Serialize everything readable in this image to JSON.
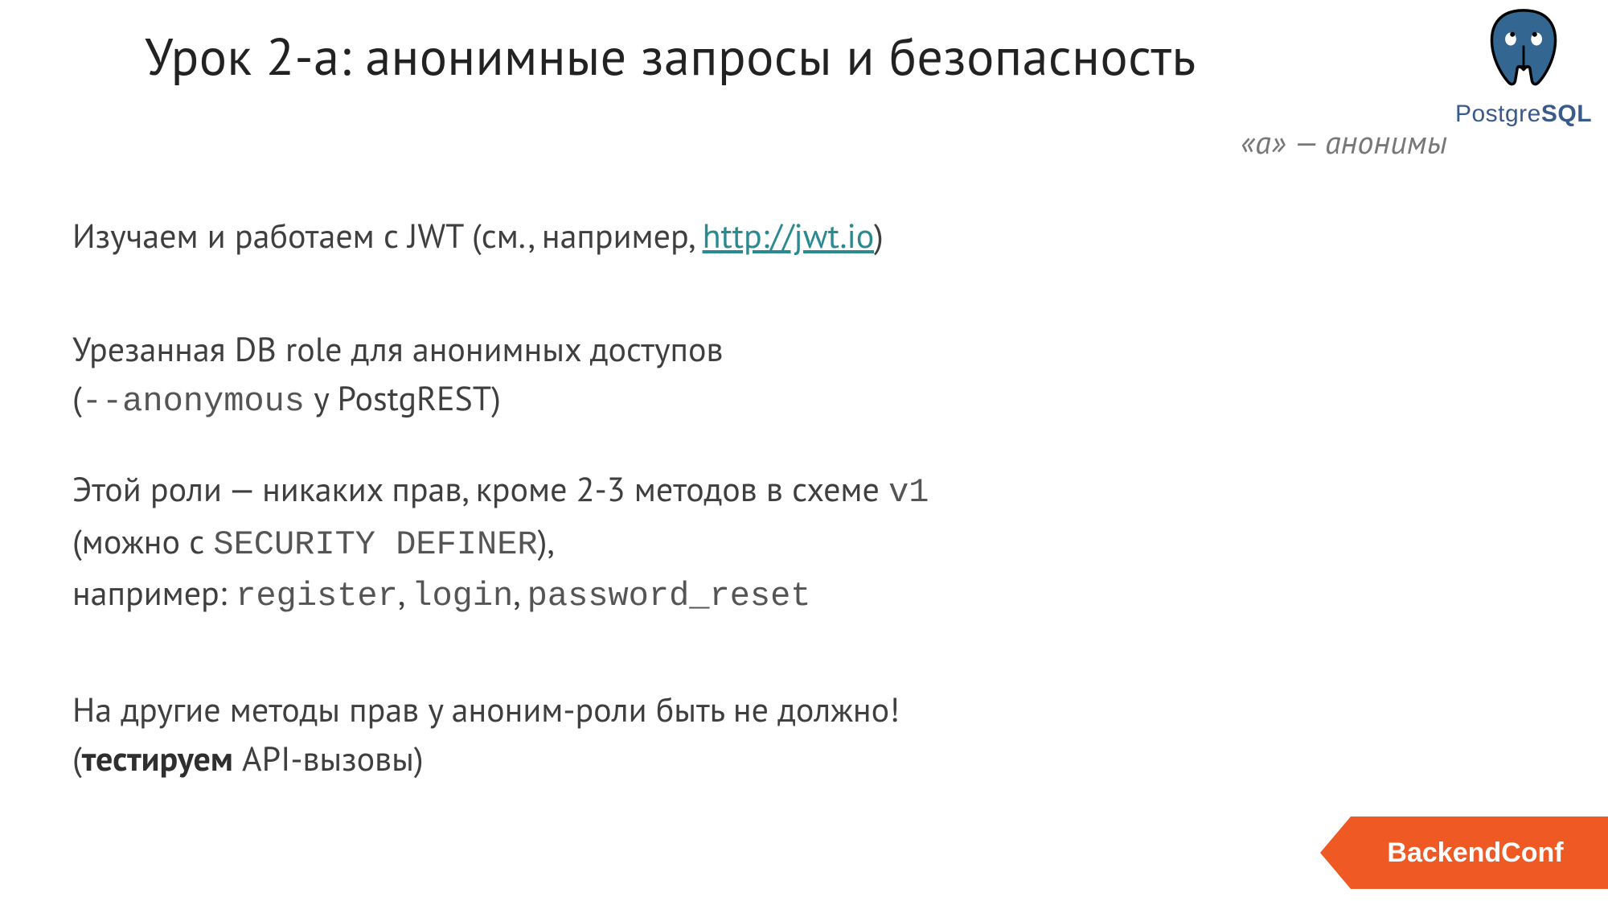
{
  "title": "Урок 2-а: анонимные запросы и безопасность",
  "subtitle": "«а» — анонимы",
  "p1_a": "Изучаем и работаем с JWT (см., например, ",
  "p1_link": "http://jwt.io",
  "p1_b": ")",
  "p2_a": "Урезанная DB role для анонимных доступов",
  "p2_b1": "(",
  "p2_code": "--anonymous",
  "p2_b2": " у PostgREST)",
  "p3_a": "Этой роли — никаких прав, кроме 2-3 методов в схеме ",
  "p3_code1": "v1",
  "p3_b": "(можно с ",
  "p3_code2": "SECURITY DEFINER",
  "p3_c": "),",
  "p3_d": "например: ",
  "p3_code3": "register",
  "p3_e": ", ",
  "p3_code4": "login",
  "p3_f": ", ",
  "p3_code5": "password_reset",
  "p4_a": "На другие методы прав у аноним-роли быть не должно!",
  "p4_b1": "(",
  "p4_bold": "тестируем",
  "p4_b2": " API-вызовы)",
  "logo_text_a": "Postgre",
  "logo_text_b": "SQL",
  "footer": "BackendConf"
}
